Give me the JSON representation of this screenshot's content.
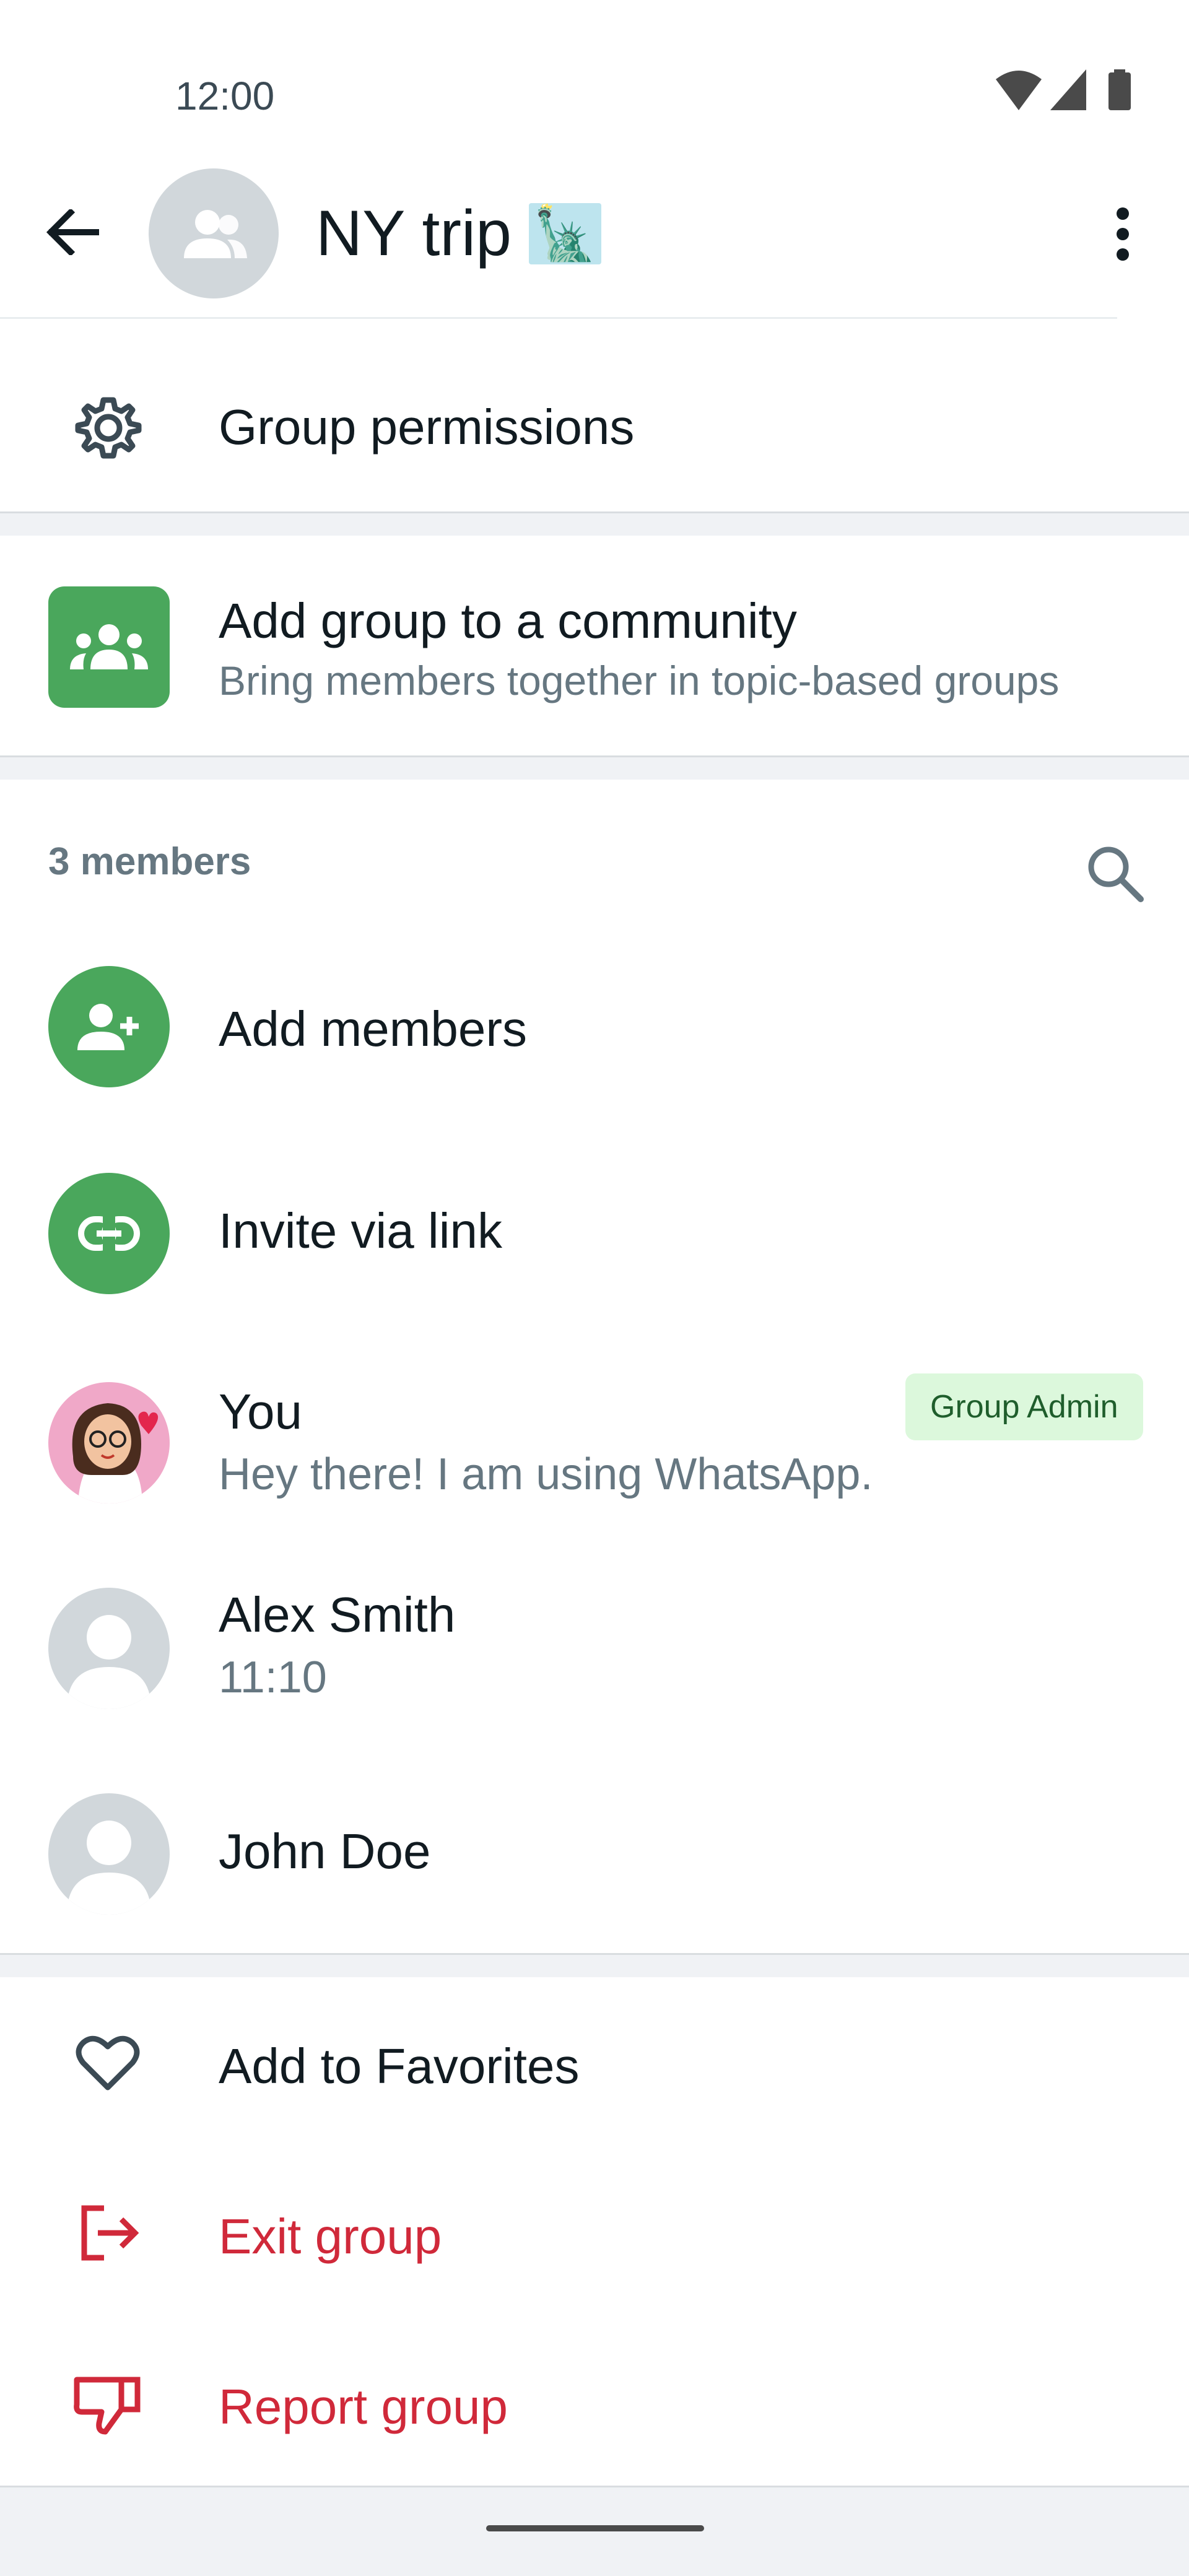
{
  "status_bar": {
    "time": "12:00"
  },
  "header": {
    "title": "NY trip",
    "title_emoji": "🗽"
  },
  "settings": {
    "group_permissions": "Group permissions"
  },
  "community": {
    "title": "Add group to a community",
    "subtitle": "Bring members together in topic-based groups"
  },
  "members": {
    "count_label": "3 members",
    "add_members": "Add members",
    "invite_link": "Invite via link",
    "list": [
      {
        "name": "You",
        "subtitle": "Hey there! I am using WhatsApp.",
        "badge": "Group Admin"
      },
      {
        "name": "Alex Smith",
        "subtitle": "11:10"
      },
      {
        "name": "John Doe"
      }
    ]
  },
  "actions": {
    "favorites": "Add to Favorites",
    "exit": "Exit group",
    "report": "Report group"
  },
  "colors": {
    "accent_green": "#4aa75c",
    "danger_red": "#d0293a",
    "badge_bg": "#dcf8dc",
    "band_gray": "#f0f2f5"
  }
}
